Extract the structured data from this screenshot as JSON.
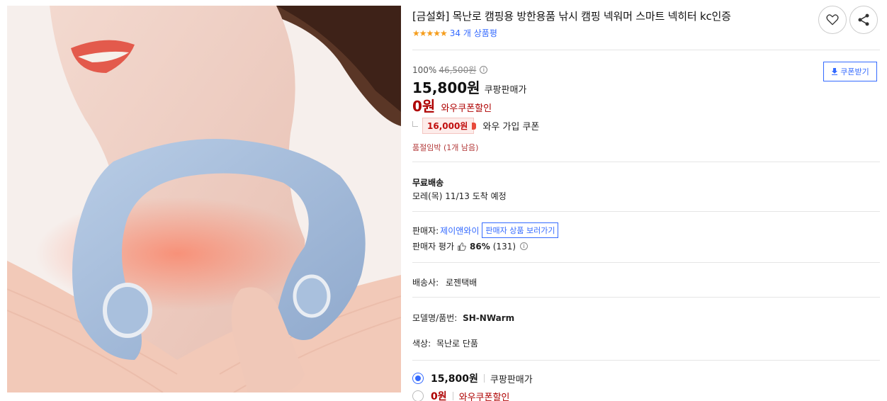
{
  "product": {
    "title": "[금설화] 목난로 캠핑용 방한용품 낚시 캠핑 넥워머 스마트 넥히터 kc인증",
    "stars": "★★★★★",
    "review_count": "34 개 상품평"
  },
  "pricing": {
    "discount_rate": "100%",
    "original_price": "46,500원",
    "price": "15,800원",
    "price_label": "쿠팡판매가",
    "wow_price": "0원",
    "wow_label": "와우쿠폰할인",
    "signup_coupon": "16,000원",
    "signup_label": "와우 가입 쿠폰",
    "low_stock": "품절임박 (1개 남음)",
    "coupon_button": "쿠폰받기"
  },
  "shipping": {
    "title": "무료배송",
    "eta": "모레(목) 11/13 도착 예정"
  },
  "seller": {
    "label": "판매자:",
    "name": "제이앤와이",
    "link": "판매자 상품 보러가기",
    "rating_label": "판매자 평가",
    "rating_pct": "86%",
    "rating_count": "(131)"
  },
  "details": {
    "courier_label": "배송사:",
    "courier": "로젠택배",
    "model_label": "모델명/품번:",
    "model": "SH-NWarm",
    "color_label": "색상:",
    "color": "목난로 단품"
  },
  "options": [
    {
      "price": "15,800원",
      "label": "쿠팡판매가",
      "selected": true
    },
    {
      "price": "0원",
      "label": "와우쿠폰할인",
      "selected": false
    }
  ],
  "colors": {
    "accent_blue": "#346aff",
    "wow_red": "#ae0000",
    "star_orange": "#f59d1c"
  },
  "icons": {
    "wishlist": "heart-icon",
    "share": "share-icon",
    "download": "download-icon",
    "info": "info-icon",
    "thumbs": "thumbs-up-icon"
  }
}
